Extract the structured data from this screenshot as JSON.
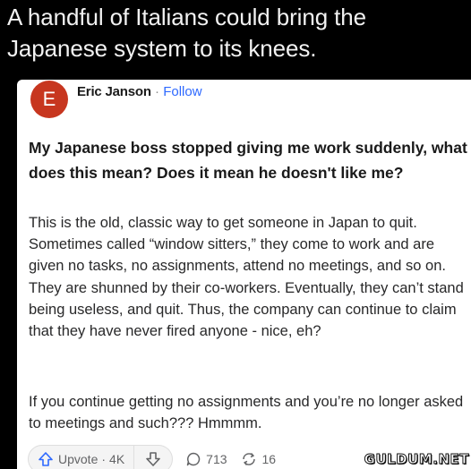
{
  "caption": {
    "line1": "A handful of Italians could bring the",
    "line2": "Japanese system to its knees."
  },
  "post": {
    "avatar_letter": "E",
    "author_name": "Eric Janson",
    "separator": "·",
    "follow_label": "Follow",
    "question": "My Japanese boss stopped giving me work suddenly, what does this mean? Does it mean he doesn't like me?",
    "answer_paragraph_1": "This is the old, classic way to get someone in Japan to quit. Sometimes called “window sitters,” they come to work and are given no tasks, no assignments, attend no meetings, and so on. They are shunned by their co-workers. Eventually, they can’t stand being useless, and quit. Thus, the company can continue to claim that they have never fired anyone - nice, eh?",
    "answer_paragraph_2": "If you continue getting no assignments and you’re no longer asked to meetings and such??? Hmmmm."
  },
  "actions": {
    "upvote_label": "Upvote",
    "upvote_separator": "·",
    "upvote_count": "4K",
    "comment_count": "713",
    "share_count": "16",
    "icons": [
      "upvote-arrow-icon",
      "downvote-arrow-icon",
      "comment-bubble-icon",
      "share-arrows-icon"
    ]
  },
  "watermark": {
    "text": "GULDUM.NET"
  },
  "colors": {
    "background": "#000000",
    "card": "#ffffff",
    "avatar": "#c7361f",
    "follow_link": "#2e69ff",
    "action_text": "#636466"
  }
}
